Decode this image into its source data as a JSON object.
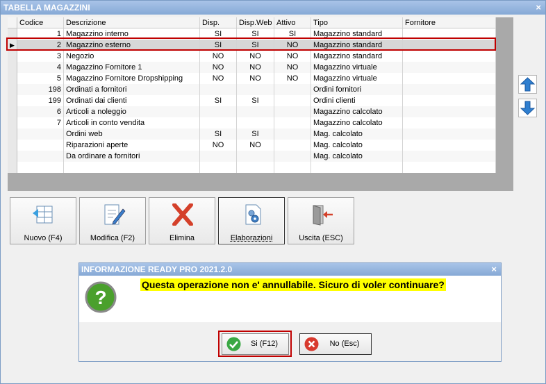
{
  "window": {
    "title": "TABELLA MAGAZZINI",
    "close": "×"
  },
  "table": {
    "columns": [
      "Codice",
      "Descrizione",
      "Disp.",
      "Disp.Web",
      "Attivo",
      "Tipo",
      "Fornitore"
    ],
    "rows": [
      [
        "1",
        "Magazzino interno",
        "SI",
        "SI",
        "SI",
        "Magazzino standard",
        ""
      ],
      [
        "2",
        "Magazzino esterno",
        "SI",
        "SI",
        "NO",
        "Magazzino standard",
        ""
      ],
      [
        "3",
        "Negozio",
        "NO",
        "NO",
        "NO",
        "Magazzino standard",
        ""
      ],
      [
        "4",
        "Magazzino Fornitore 1",
        "NO",
        "NO",
        "NO",
        "Magazzino virtuale",
        ""
      ],
      [
        "5",
        "Magazzino Fornitore Dropshipping",
        "NO",
        "NO",
        "NO",
        "Magazzino virtuale",
        ""
      ],
      [
        "198",
        "Ordinati a fornitori",
        "",
        "",
        "",
        "Ordini fornitori",
        ""
      ],
      [
        "199",
        "Ordinati dai clienti",
        "SI",
        "SI",
        "",
        "Ordini clienti",
        ""
      ],
      [
        "6",
        "Articoli a noleggio",
        "",
        "",
        "",
        "Magazzino calcolato",
        ""
      ],
      [
        "7",
        "Articoli in conto vendita",
        "",
        "",
        "",
        "Magazzino calcolato",
        ""
      ],
      [
        "",
        "Ordini web",
        "SI",
        "SI",
        "",
        "Mag. calcolato",
        ""
      ],
      [
        "",
        "Riparazioni aperte",
        "NO",
        "NO",
        "",
        "Mag. calcolato",
        ""
      ],
      [
        "",
        "Da ordinare a fornitori",
        "",
        "",
        "",
        "Mag. calcolato",
        ""
      ]
    ],
    "selected_row_indicator": "▶"
  },
  "toolbar": {
    "new": "Nuovo (F4)",
    "edit": "Modifica (F2)",
    "delete": "Elimina",
    "process": "Elaborazioni",
    "exit": "Uscita (ESC)"
  },
  "dialog": {
    "title": "INFORMAZIONE READY PRO 2021.2.0",
    "close": "×",
    "message": "Questa operazione non e' annullabile. Sicuro di voler continuare?",
    "yes_label": "Si (F12)",
    "no_label": "No (Esc)",
    "question_glyph": "?"
  },
  "colors": {
    "highlight_frame": "#c00000",
    "message_bg": "#ffff00",
    "titlebar": "#86a9d6"
  }
}
